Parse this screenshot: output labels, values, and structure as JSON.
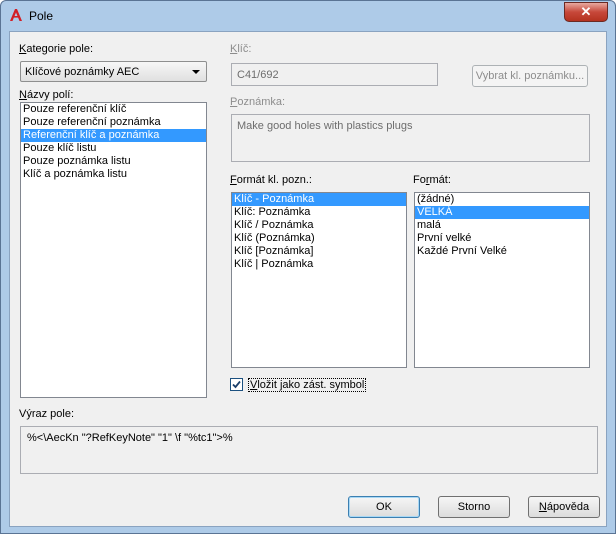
{
  "window": {
    "title": "Pole",
    "close_glyph": "✕"
  },
  "left": {
    "category_label_prefix": "K",
    "category_label_rest": "ategorie pole:",
    "category_value": "Klíčové poznámky AEC",
    "fields_label_prefix": "N",
    "fields_label_rest": "ázvy polí:",
    "fields": [
      {
        "label": "Pouze referenční klíč",
        "selected": false
      },
      {
        "label": "Pouze referenční poznámka",
        "selected": false
      },
      {
        "label": "Referenční klíč a poznámka",
        "selected": true
      },
      {
        "label": "Pouze klíč listu",
        "selected": false
      },
      {
        "label": "Pouze poznámka listu",
        "selected": false
      },
      {
        "label": "Klíč a poznámka listu",
        "selected": false
      }
    ]
  },
  "right": {
    "key_label_prefix": "K",
    "key_label_rest": "líč:",
    "key_value": "C41/692",
    "select_key_button": "Vybrat kl. poznámku...",
    "note_label_prefix": "P",
    "note_label_rest": "oznámka:",
    "note_value": "Make good holes with plastics plugs",
    "key_format_label_prefix": "F",
    "key_format_label_rest": "ormát kl. pozn.:",
    "key_formats": [
      {
        "label": "Klíč - Poznámka",
        "selected": true
      },
      {
        "label": "Klíč: Poznámka",
        "selected": false
      },
      {
        "label": "Klíč / Poznámka",
        "selected": false
      },
      {
        "label": "Klíč (Poznámka)",
        "selected": false
      },
      {
        "label": "Klíč [Poznámka]",
        "selected": false
      },
      {
        "label": "Klíč | Poznámka",
        "selected": false
      }
    ],
    "format_label_prefix": "r",
    "format_label_before": "Fo",
    "format_label_rest": "mát:",
    "formats": [
      {
        "label": "(žádné)",
        "selected": false
      },
      {
        "label": "VELKÁ",
        "selected": true
      },
      {
        "label": "malá",
        "selected": false
      },
      {
        "label": "První velké",
        "selected": false
      },
      {
        "label": "Každé První Velké",
        "selected": false
      }
    ],
    "placeholder_checkbox_prefix": "V",
    "placeholder_checkbox_rest": "ložit jako zást. symbol",
    "placeholder_checked": true
  },
  "expression": {
    "label": "Výraz pole:",
    "value": "%<\\AecKn \"?RefKeyNote\" \"1\" \\f \"%tc1\">%"
  },
  "buttons": {
    "ok": "OK",
    "cancel": "Storno",
    "help_prefix": "N",
    "help_rest": "ápověda"
  },
  "colors": {
    "selection": "#3399ff",
    "close": "#c7483a",
    "app_icon": "#d21f26"
  }
}
